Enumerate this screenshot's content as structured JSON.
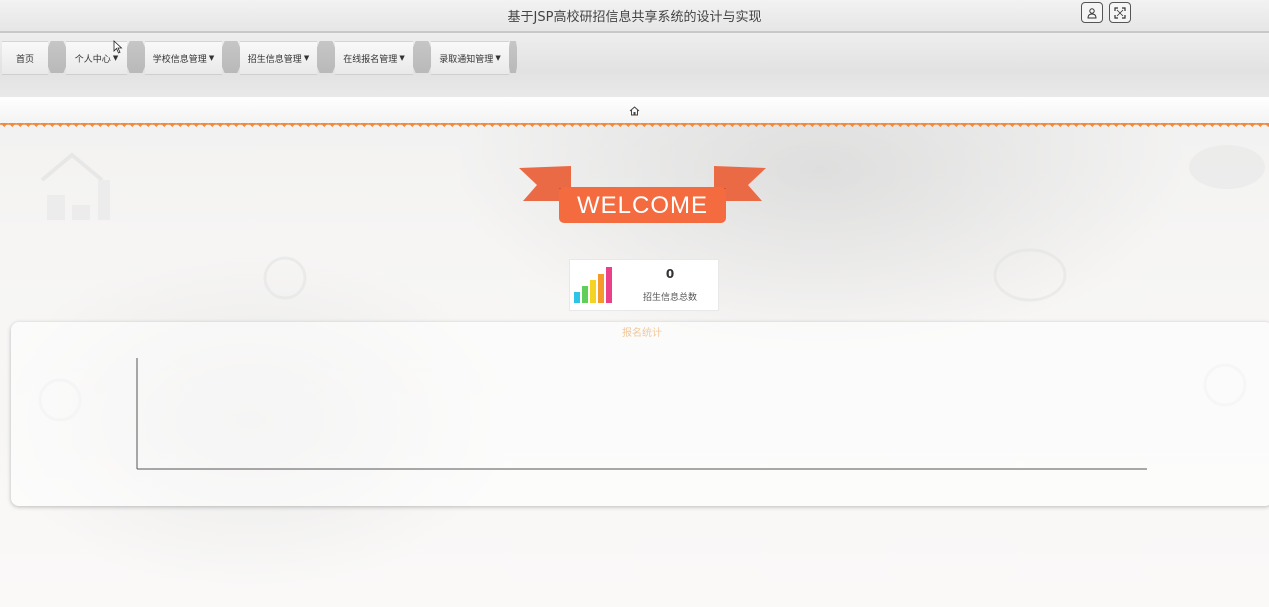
{
  "app": {
    "title": "基于JSP高校研招信息共享系统的设计与实现"
  },
  "topbar": {
    "user_icon": "user-icon",
    "fullscreen_icon": "fullscreen-icon"
  },
  "nav": {
    "items": [
      {
        "label": "首页",
        "has_dropdown": false
      },
      {
        "label": "个人中心",
        "has_dropdown": true
      },
      {
        "label": "学校信息管理",
        "has_dropdown": true
      },
      {
        "label": "招生信息管理",
        "has_dropdown": true
      },
      {
        "label": "在线报名管理",
        "has_dropdown": true
      },
      {
        "label": "录取通知管理",
        "has_dropdown": true
      }
    ]
  },
  "breadcrumb": {
    "icon": "home-icon"
  },
  "welcome": {
    "text": "WELCOME",
    "ribbon_color": "#f36b3f",
    "ribbon_dark": "#d9502a"
  },
  "stats": [
    {
      "value": "0",
      "label": "招生信息总数",
      "icon": "bar-chart-icon"
    }
  ],
  "chart": {
    "title": "报名统计"
  },
  "chart_data": {
    "type": "bar",
    "title": "报名统计",
    "categories": [],
    "series": []
  },
  "colors": {
    "accent": "#f08a3c",
    "chart_title": "#f2c89a"
  }
}
